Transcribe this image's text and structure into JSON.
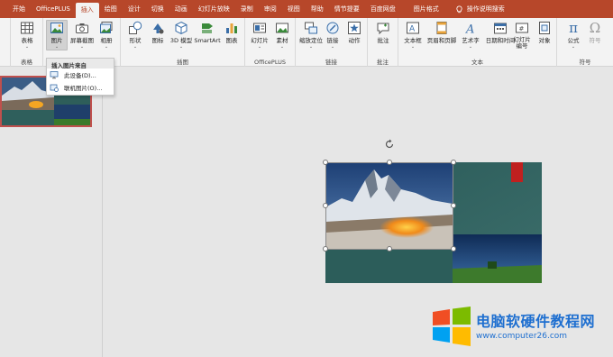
{
  "tabs": [
    "开始",
    "OfficePLUS",
    "插入",
    "绘图",
    "设计",
    "切换",
    "动画",
    "幻灯片放映",
    "录制",
    "审阅",
    "视图",
    "帮助",
    "情节提要",
    "百度网盘"
  ],
  "active_tab": "插入",
  "context_tab": "图片格式",
  "tellme": "操作说明搜索",
  "ribbon": {
    "buttons": {
      "table": "表格",
      "picture": "图片",
      "screenshot": "屏幕截图",
      "album": "相册",
      "shapes": "形状",
      "icons": "图标",
      "model3d": "3D 模型",
      "smartart": "SmartArt",
      "chart": "图表",
      "slide": "幻灯片",
      "material": "素材",
      "zoom": "缩放定位",
      "link": "链接",
      "action": "动作",
      "comment": "批注",
      "textbox": "文本框",
      "headerfooter": "页眉和页脚",
      "wordart": "艺术字",
      "datetime": "日期和时间",
      "slidenum": "幻灯片编号",
      "object": "对象",
      "equation": "公式",
      "symbol": "符号"
    },
    "groups": {
      "tables": "表格",
      "images": "图像",
      "illustrations": "插图",
      "officeplus": "OfficePLUS",
      "links": "链接",
      "comments": "批注",
      "text": "文本",
      "symbols": "符号"
    }
  },
  "dropdown": {
    "title": "插入图片来自",
    "items": [
      "此设备(D)...",
      "联机图片(O)..."
    ]
  },
  "watermark": {
    "line1": "电脑软硬件教程网",
    "line2": "www.computer26.com"
  },
  "colors": {
    "accent": "#b7472a",
    "slide_teal": "#2f5f5c",
    "watermark_blue": "#1e6fd0"
  }
}
